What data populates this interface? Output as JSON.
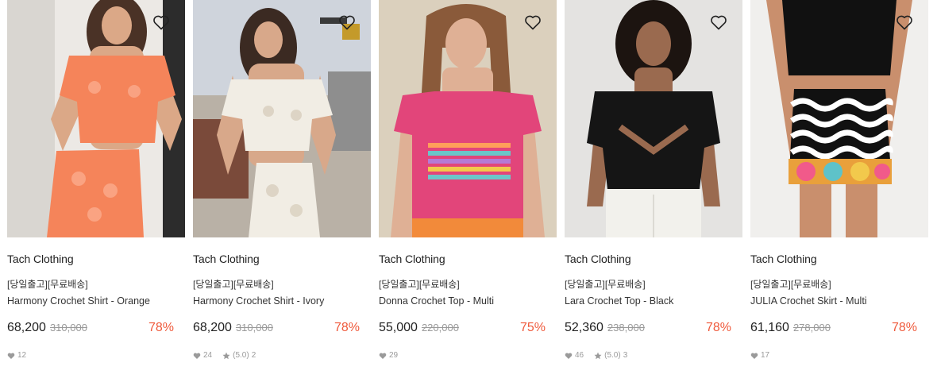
{
  "products": [
    {
      "brand": "Tach Clothing",
      "tag": "[당일출고][무료배송]",
      "name": "Harmony Crochet Shirt - Orange",
      "price": "68,200",
      "original_price": "310,000",
      "discount": "78%",
      "likes": "12",
      "rating": null,
      "review_count": null,
      "colors": {
        "bg": "#e9e6e2",
        "garment": "#f5845a",
        "skin": "#dba887",
        "hair": "#4a3226"
      }
    },
    {
      "brand": "Tach Clothing",
      "tag": "[당일출고][무료배송]",
      "name": "Harmony Crochet Shirt - Ivory",
      "price": "68,200",
      "original_price": "310,000",
      "discount": "78%",
      "likes": "24",
      "rating": "(5.0)",
      "review_count": "2",
      "colors": {
        "bg": "#c9ced6",
        "garment": "#f1ede4",
        "skin": "#d8a88a",
        "hair": "#3b2a22"
      }
    },
    {
      "brand": "Tach Clothing",
      "tag": "[당일출고][무료배송]",
      "name": "Donna Crochet Top - Multi",
      "price": "55,000",
      "original_price": "220,000",
      "discount": "75%",
      "likes": "29",
      "rating": null,
      "review_count": null,
      "colors": {
        "bg": "#d9cdb9",
        "garment": "#e2457a",
        "skin": "#dfb095",
        "hair": "#8a5a3a"
      }
    },
    {
      "brand": "Tach Clothing",
      "tag": "[당일출고][무료배송]",
      "name": "Lara Crochet Top - Black",
      "price": "52,360",
      "original_price": "238,000",
      "discount": "78%",
      "likes": "46",
      "rating": "(5.0)",
      "review_count": "3",
      "colors": {
        "bg": "#e4e3e1",
        "garment": "#151515",
        "skin": "#9a6a4f",
        "hair": "#1c1410"
      }
    },
    {
      "brand": "Tach Clothing",
      "tag": "[당일출고][무료배송]",
      "name": "JULIA Crochet Skirt - Multi",
      "price": "61,160",
      "original_price": "278,000",
      "discount": "78%",
      "likes": "17",
      "rating": null,
      "review_count": null,
      "colors": {
        "bg": "#efeeec",
        "garment": "#111111",
        "skin": "#c98f6d",
        "hair": "#2a1d17"
      }
    }
  ],
  "icons": {
    "wishlist": "heart-outline-icon",
    "likes": "heart-icon",
    "rating": "star-icon"
  }
}
